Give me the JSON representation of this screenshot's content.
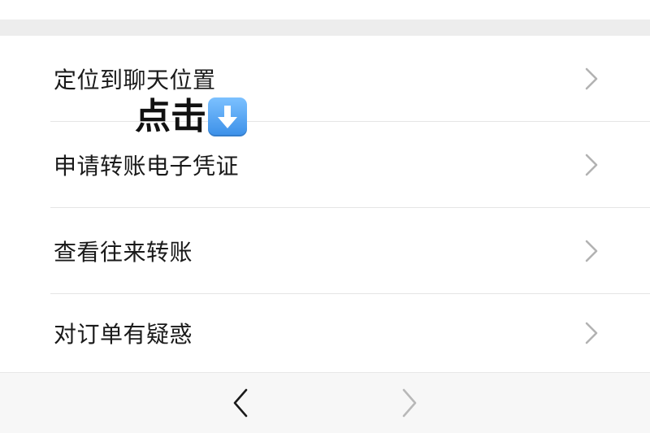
{
  "menu": {
    "items": [
      {
        "label": "定位到聊天位置"
      },
      {
        "label": "申请转账电子凭证"
      },
      {
        "label": "查看往来转账"
      },
      {
        "label": "对订单有疑惑"
      }
    ]
  },
  "annotation": {
    "text": "点击",
    "icon": "arrow-down-box-icon",
    "icon_color": "#4a9ff5"
  },
  "bottom_nav": {
    "back_icon": "chevron-left-icon",
    "forward_icon": "chevron-right-icon",
    "back_color": "#1a1a1a",
    "forward_color": "#b8b8b8"
  },
  "colors": {
    "separator": "#ededed",
    "chevron": "#b2b2b2",
    "text": "#1a1a1a",
    "bottom_bar": "#f7f7f7"
  }
}
